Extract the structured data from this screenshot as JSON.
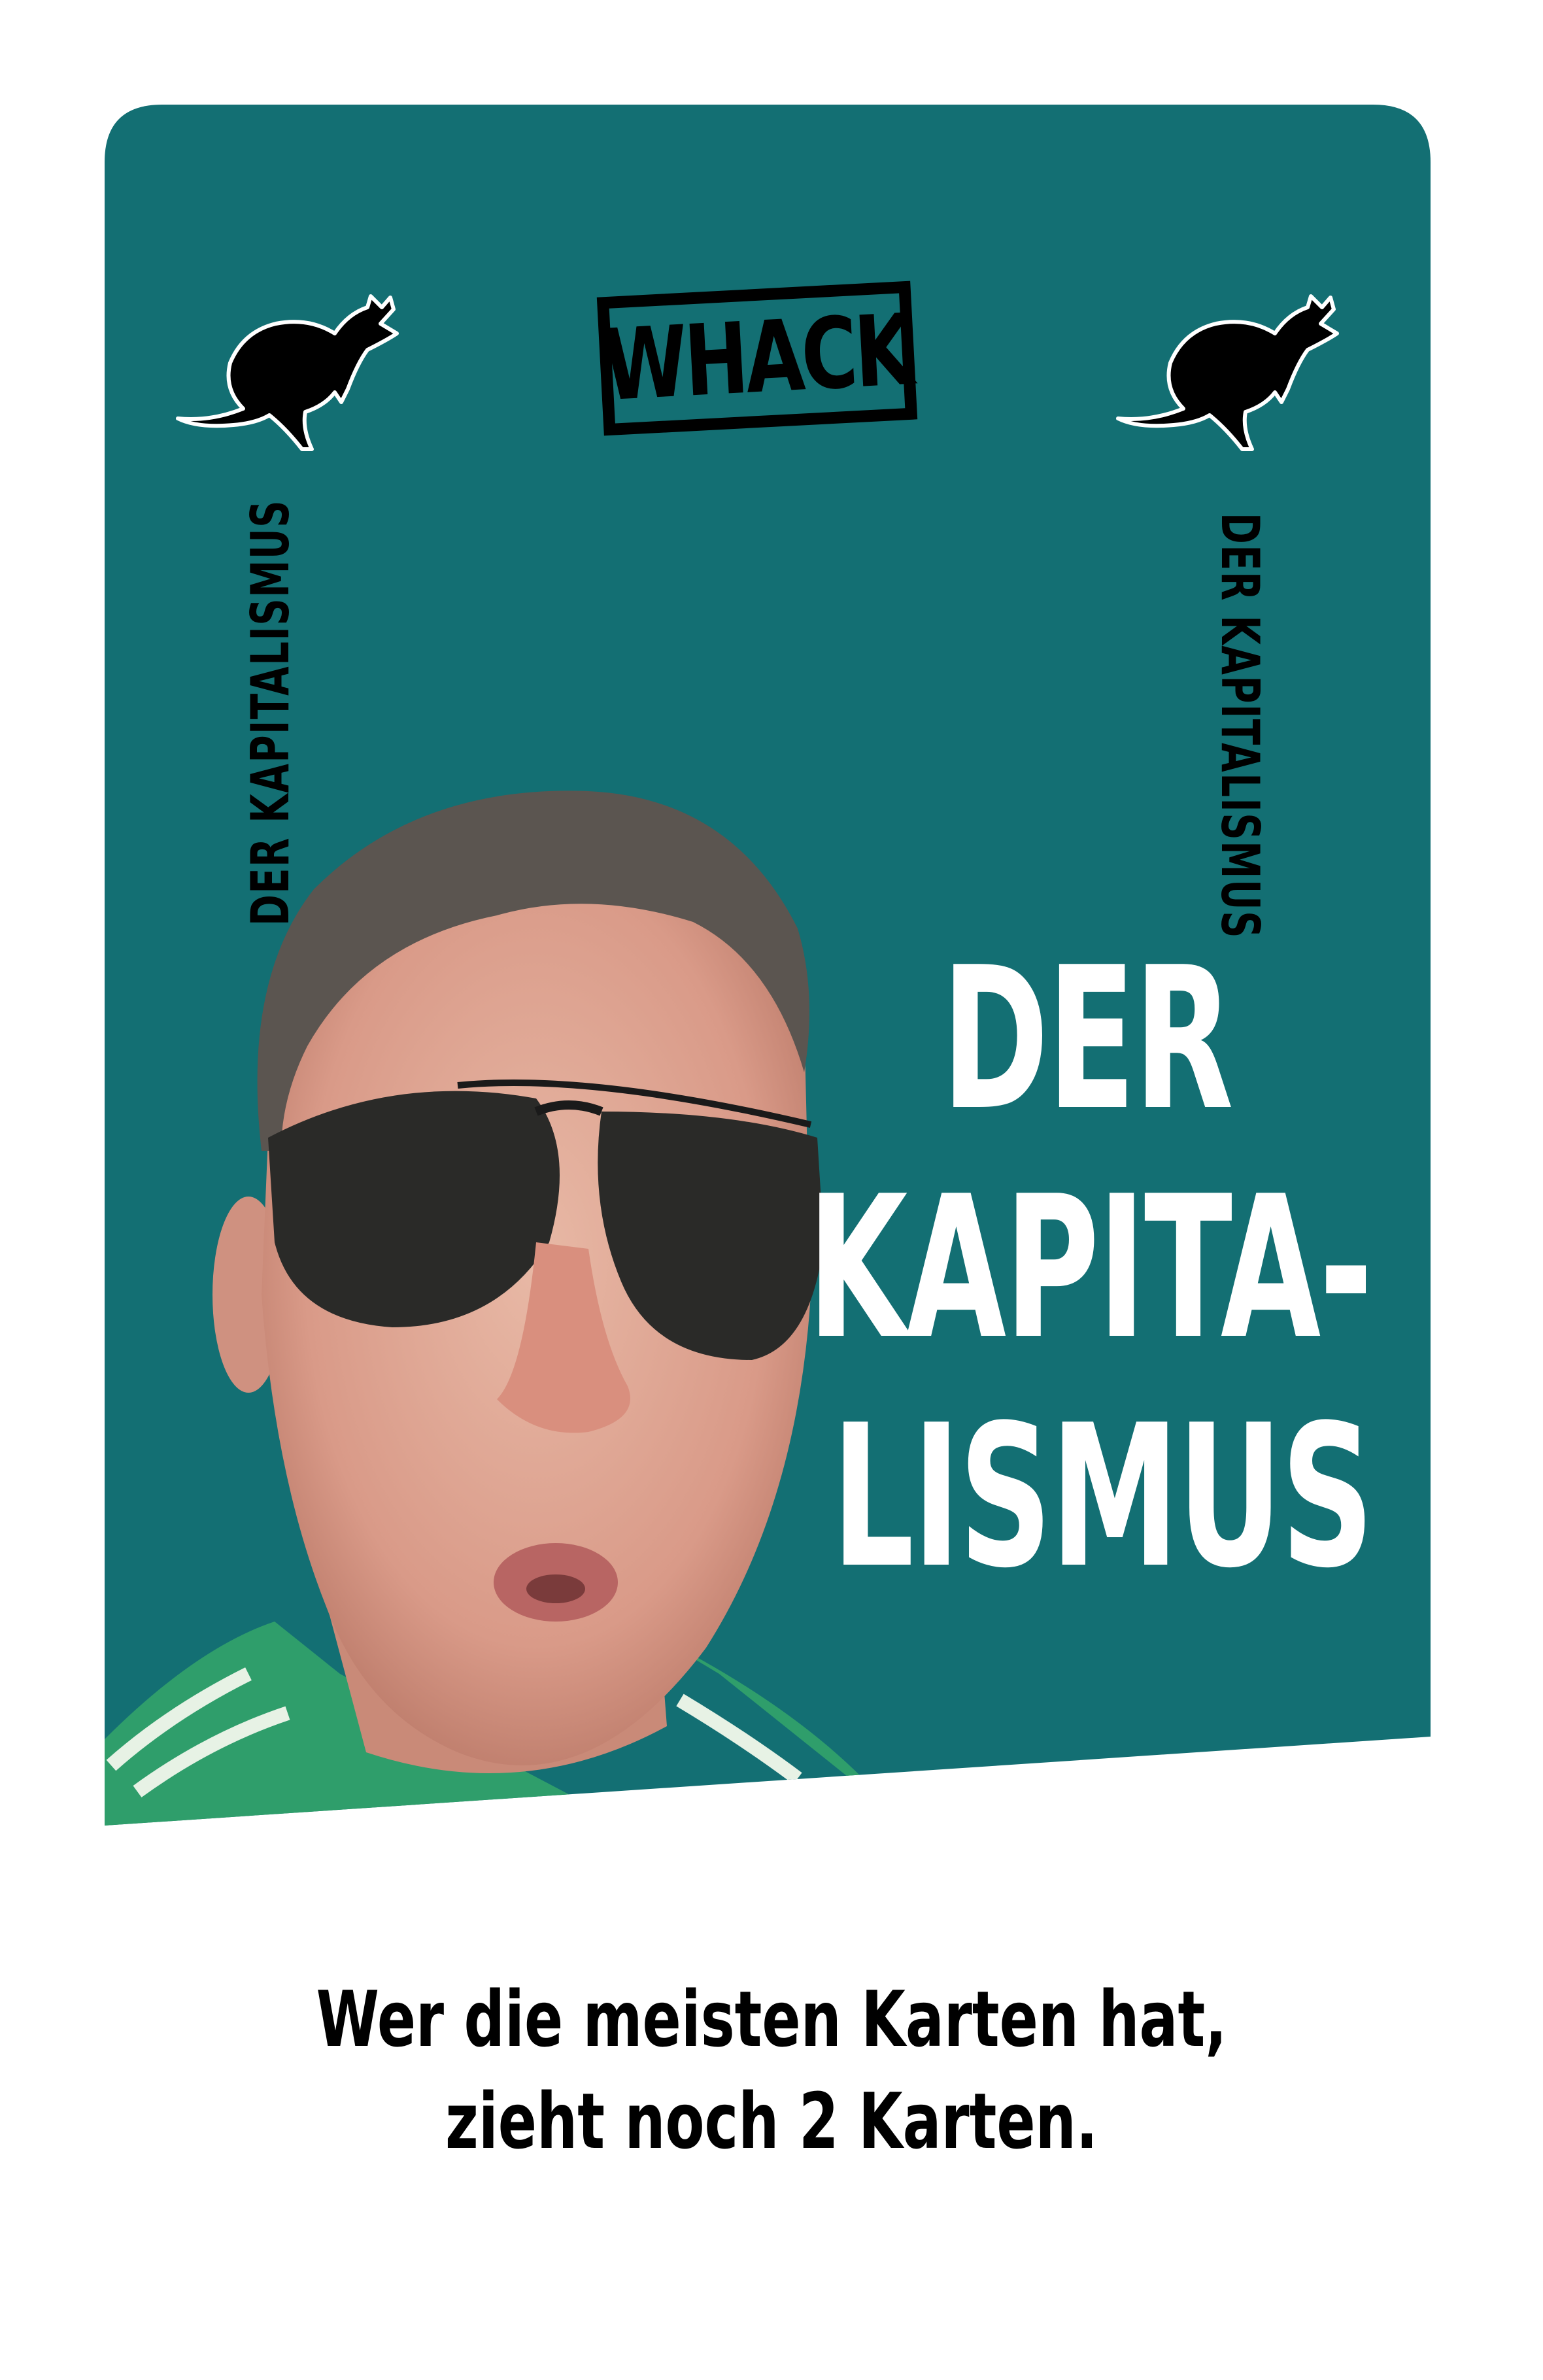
{
  "card": {
    "logo_text": "WHACK",
    "side_label_left": "DER KAPITALISMUS",
    "side_label_right": "DER KAPITALISMUS",
    "title_lines": [
      "DER",
      "KAPITA-",
      "LISMUS"
    ],
    "instruction_lines": [
      "Wer die meisten Karten hat,",
      "zieht noch 2 Karten."
    ],
    "icons": [
      "kangaroo-icon",
      "kangaroo-icon"
    ],
    "photo": "portrait-photo",
    "colors": {
      "panel": "#136f73",
      "title": "#ffffff",
      "text": "#000000",
      "background": "#ffffff"
    }
  }
}
